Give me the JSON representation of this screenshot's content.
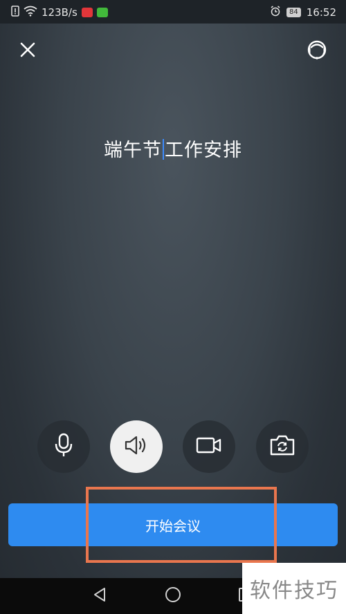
{
  "statusbar": {
    "net_speed": "123B/s",
    "battery": "84",
    "time": "16:52"
  },
  "meeting": {
    "title_before": "端午节",
    "title_after": "工作安排"
  },
  "controls": {
    "mic": "mic-icon",
    "speaker": "speaker-icon",
    "camera": "video-camera-icon",
    "switch_camera": "switch-camera-icon",
    "speaker_active": true
  },
  "actions": {
    "start_label": "开始会议"
  },
  "watermark": {
    "text": "软件技巧"
  },
  "colors": {
    "primary": "#2e8bf0",
    "annotation": "#e9764e",
    "cursor": "#3d8bfd"
  }
}
